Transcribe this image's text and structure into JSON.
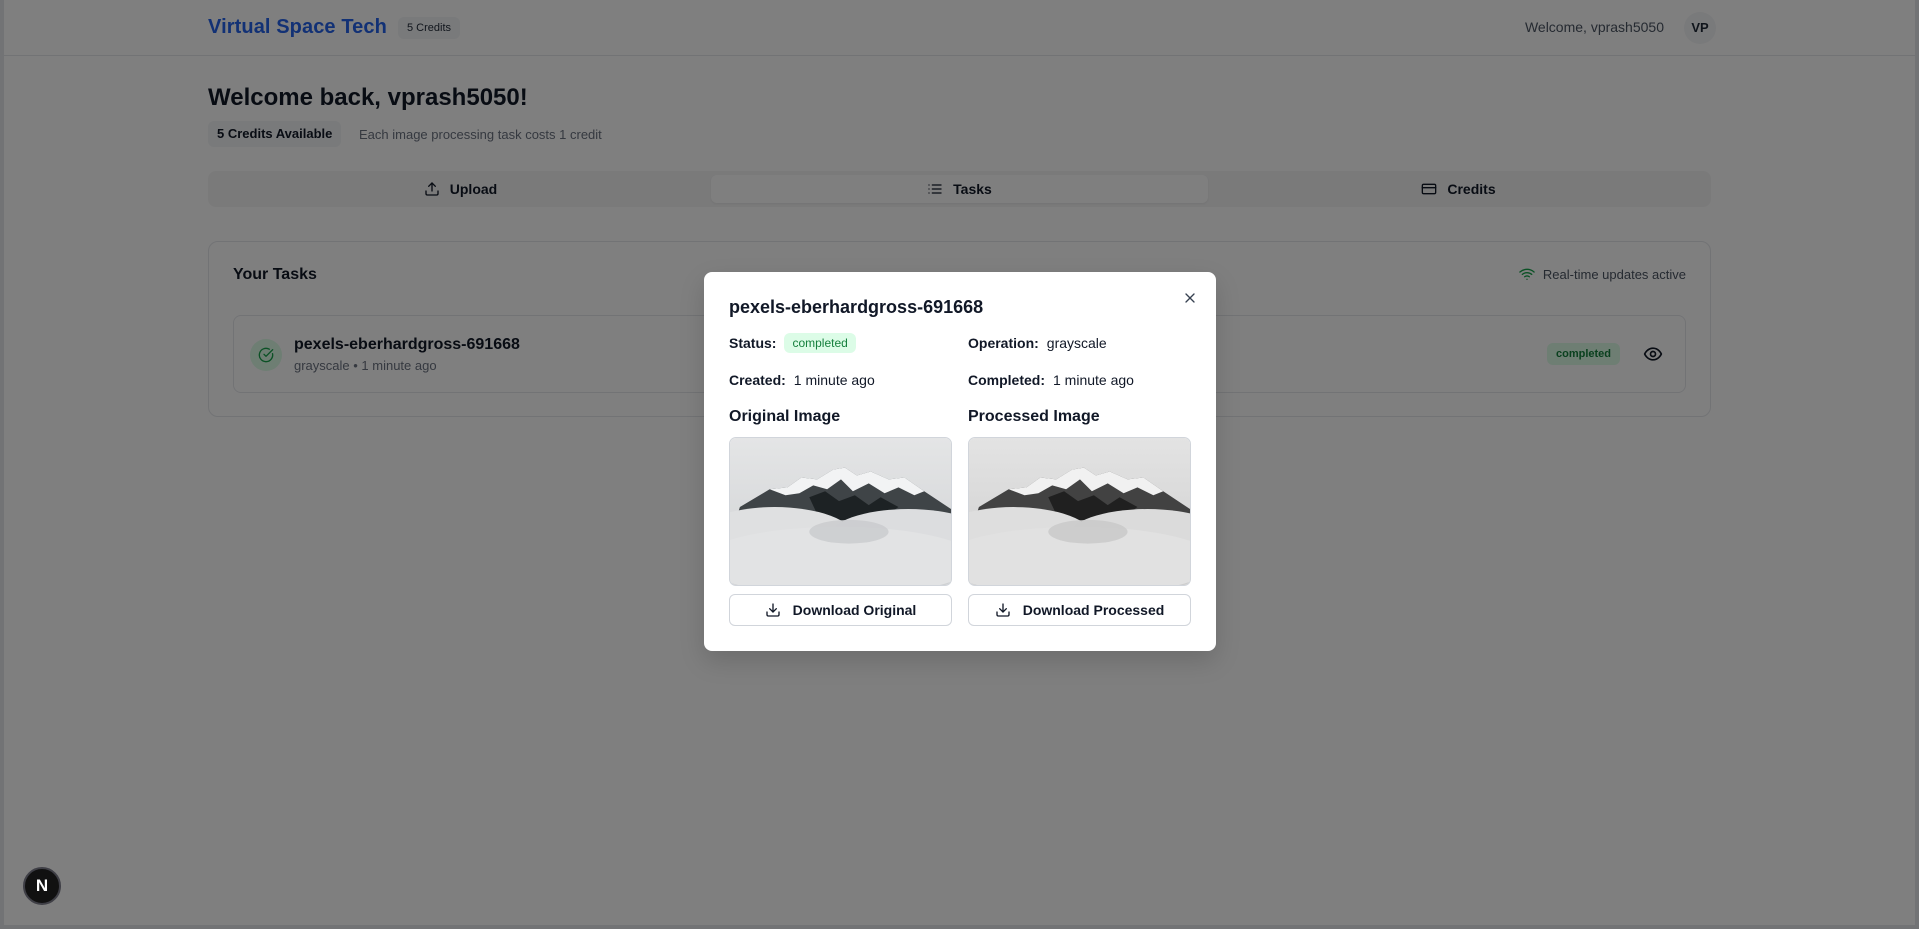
{
  "header": {
    "brand": "Virtual Space Tech",
    "credits_pill": "5 Credits",
    "welcome": "Welcome, vprash5050",
    "avatar_initials": "VP"
  },
  "greeting": {
    "title": "Welcome back, vprash5050!",
    "credits_available": "5 Credits Available",
    "credit_note": "Each image processing task costs 1 credit"
  },
  "tabs": [
    {
      "label": "Upload",
      "icon": "upload-icon",
      "active": false
    },
    {
      "label": "Tasks",
      "icon": "list-icon",
      "active": true
    },
    {
      "label": "Credits",
      "icon": "credit-card-icon",
      "active": false
    }
  ],
  "tasks_card": {
    "title": "Your Tasks",
    "realtime": "Real-time updates active",
    "task": {
      "name": "pexels-eberhardgross-691668",
      "meta": "grayscale • 1 minute ago",
      "badge": "completed",
      "status_icon": "check-circle-icon",
      "view_icon": "eye-icon"
    }
  },
  "modal": {
    "title": "pexels-eberhardgross-691668",
    "status_label": "Status:",
    "status_value": "completed",
    "operation_label": "Operation:",
    "operation_value": "grayscale",
    "created_label": "Created:",
    "created_value": "1 minute ago",
    "completed_label": "Completed:",
    "completed_value": "1 minute ago",
    "original_title": "Original Image",
    "processed_title": "Processed Image",
    "download_original": "Download Original",
    "download_processed": "Download Processed"
  },
  "dev_badge": "N",
  "colors": {
    "brand": "#2563eb",
    "success_bg": "#dcfce7",
    "success_text": "#15803d",
    "overlay": "rgba(0,0,0,0.5)"
  }
}
